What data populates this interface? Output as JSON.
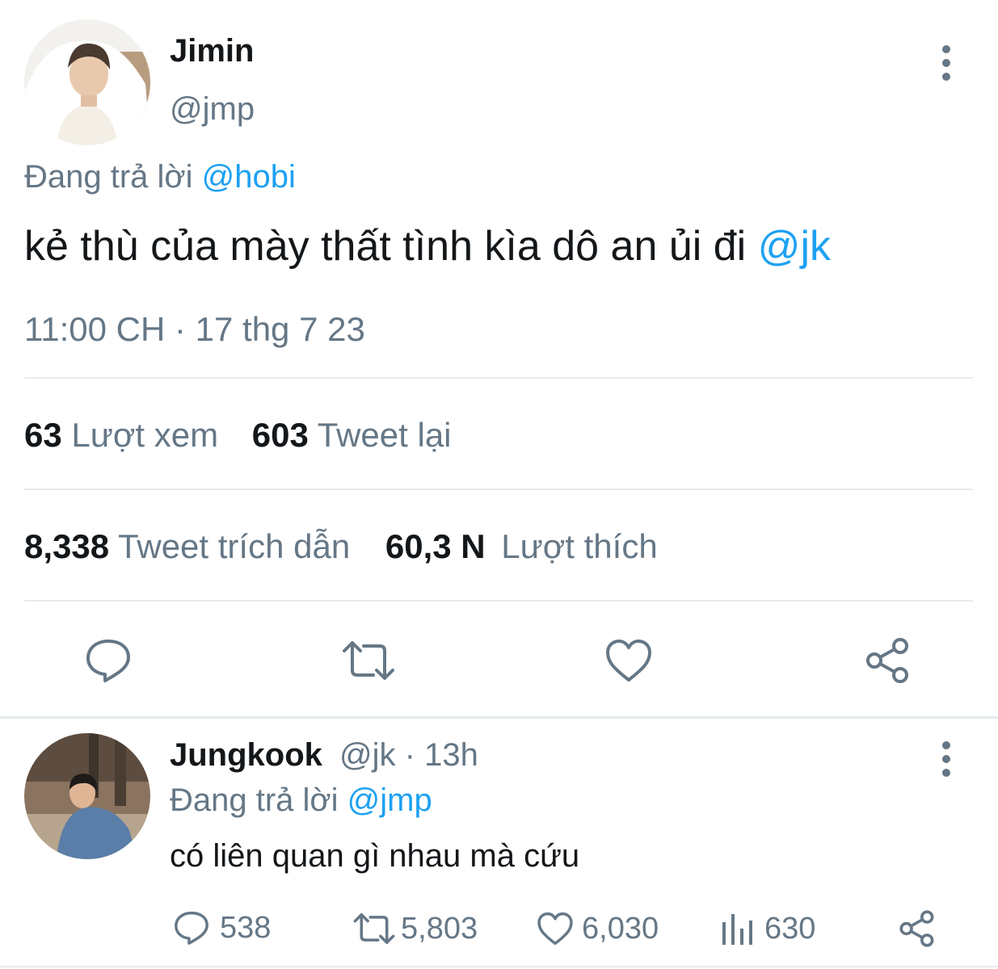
{
  "tweet": {
    "author_name": "Jimin",
    "author_handle": "@jmp",
    "reply_prefix": "Đang trả lời",
    "reply_to": "@hobi",
    "text": "kẻ thù của mày thất tình kìa dô an ủi đi",
    "mention": "@jk",
    "timestamp": "11:00 CH · 17 thg 7 23",
    "stats": {
      "views_count": "63",
      "views_label": "Lượt xem",
      "retweets_count": "603",
      "retweets_label": "Tweet lại",
      "quotes_count": "8,338",
      "quotes_label": "Tweet trích dẫn",
      "likes_count": "60,3 N",
      "likes_label": "Lượt thích"
    },
    "actions": [
      "reply-icon",
      "retweet-icon",
      "like-icon",
      "share-icon"
    ]
  },
  "reply": {
    "author_name": "Jungkook",
    "meta": "@jk · 13h",
    "reply_prefix": "Đang trả lời",
    "reply_to": "@jmp",
    "text": "có liên quan gì nhau mà cứu",
    "replies_count": "538",
    "retweets_count": "5,803",
    "likes_count": "6,030",
    "views_count": "630"
  },
  "colors": {
    "accent": "#1da1f2",
    "secondary_text": "#657786",
    "primary_text": "#14171a",
    "divider": "#e6ecf0"
  }
}
